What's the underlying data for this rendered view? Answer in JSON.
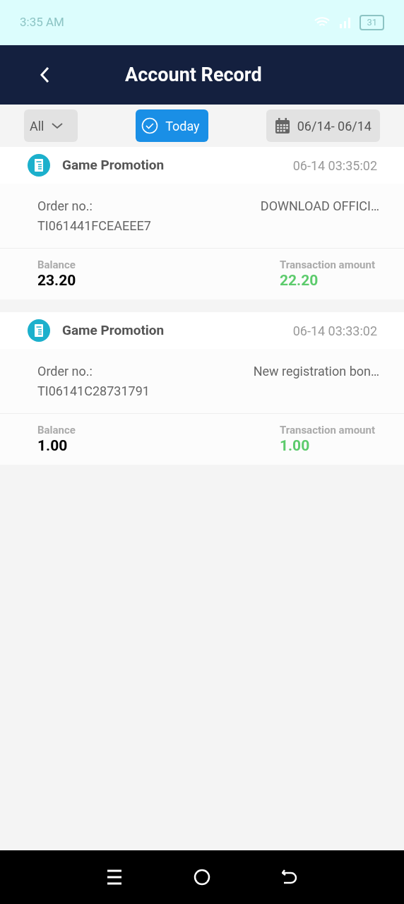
{
  "status_bar": {
    "time": "3:35 AM",
    "battery": "31"
  },
  "header": {
    "title": "Account Record"
  },
  "filters": [
    {
      "kind": "dropdown",
      "label": "All",
      "selected": false
    },
    {
      "kind": "check",
      "label": "Today",
      "selected": true
    },
    {
      "kind": "date",
      "label": "06/14- 06/14",
      "selected": false
    }
  ],
  "records": [
    {
      "type": "Game Promotion",
      "time": "06-14 03:35:02",
      "order_label": "Order no.:",
      "order_no": "TI061441FCEAEEE7",
      "remark": "DOWNLOAD OFFICI…",
      "balance_label": "Balance",
      "balance": "23.20",
      "amount_label": "Transaction amount",
      "amount": "22.20"
    },
    {
      "type": "Game Promotion",
      "time": "06-14 03:33:02",
      "order_label": "Order no.:",
      "order_no": "TI06141C28731791",
      "remark": "New registration bon…",
      "balance_label": "Balance",
      "balance": "1.00",
      "amount_label": "Transaction amount",
      "amount": "1.00"
    }
  ]
}
